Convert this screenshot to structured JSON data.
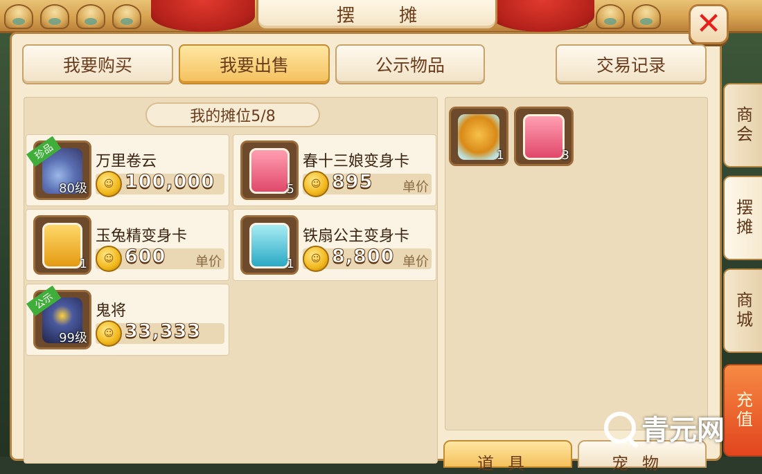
{
  "window": {
    "title": "摆  摊",
    "close_glyph": "✕"
  },
  "top_tabs": [
    {
      "label": "我要购买",
      "active": false
    },
    {
      "label": "我要出售",
      "active": true
    },
    {
      "label": "公示物品",
      "active": false
    },
    {
      "label": "交易记录",
      "active": false
    }
  ],
  "stall": {
    "title": "我的摊位5/8",
    "slots": [
      {
        "name": "万里卷云",
        "level": "80级",
        "badge": "珍品",
        "price": "100,000",
        "unit": "",
        "icon": "pet-icon"
      },
      {
        "name": "春十三娘变身卡",
        "qty": "5",
        "price": "895",
        "unit": "单价",
        "icon": "transform-card-icon"
      },
      {
        "name": "玉兔精变身卡",
        "qty": "1",
        "price": "600",
        "unit": "单价",
        "icon": "transform-card-icon"
      },
      {
        "name": "铁扇公主变身卡",
        "qty": "1",
        "price": "8,800",
        "unit": "单价",
        "icon": "transform-card-icon"
      },
      {
        "name": "鬼将",
        "level": "99级",
        "badge": "公示",
        "price": "33,333",
        "unit": "",
        "icon": "pet-icon"
      }
    ]
  },
  "inventory": [
    {
      "icon": "zongzi-food-icon",
      "qty": "1"
    },
    {
      "icon": "transform-card-icon",
      "qty": "3"
    }
  ],
  "bottom_buttons": [
    {
      "label": "道具",
      "active": true
    },
    {
      "label": "宠物",
      "active": false
    }
  ],
  "side_tabs": [
    {
      "label": "商会",
      "active": false
    },
    {
      "label": "摆摊",
      "active": true
    },
    {
      "label": "商城",
      "active": false
    },
    {
      "label": "充值",
      "active": false
    }
  ],
  "watermark": {
    "text": "青元网"
  },
  "colors": {
    "accent_gold": "#f4c05c",
    "panel_bg": "#f6ead0",
    "badge_green": "#3fae3a",
    "close_red": "#e3201c"
  }
}
